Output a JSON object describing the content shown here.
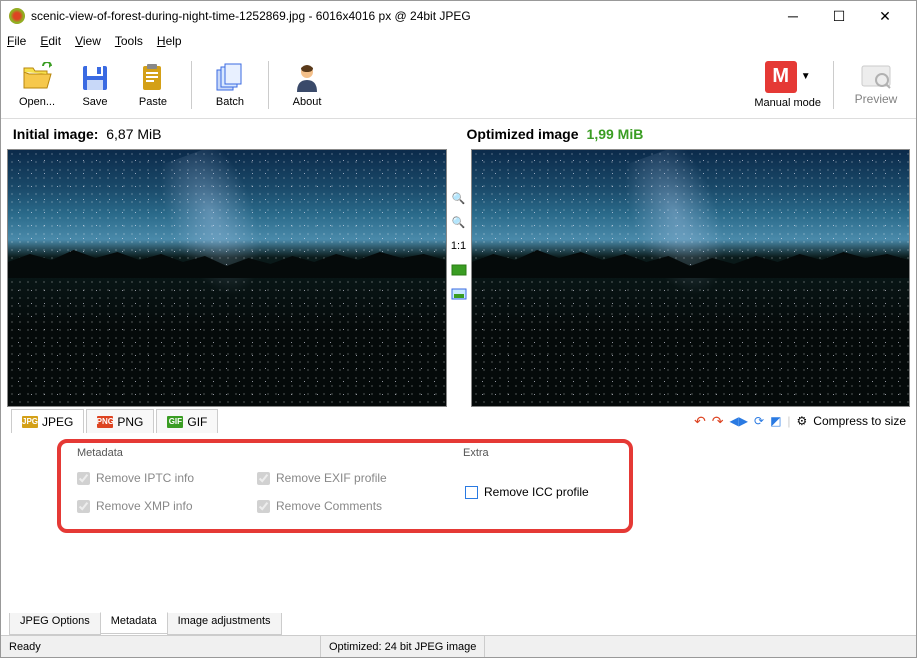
{
  "window": {
    "title": "scenic-view-of-forest-during-night-time-1252869.jpg - 6016x4016 px @ 24bit JPEG"
  },
  "menu": {
    "file": "File",
    "edit": "Edit",
    "view": "View",
    "tools": "Tools",
    "help": "Help"
  },
  "toolbar": {
    "open": "Open...",
    "save": "Save",
    "paste": "Paste",
    "batch": "Batch",
    "about": "About",
    "mode": "Manual mode",
    "preview": "Preview"
  },
  "info": {
    "initial_label": "Initial image:",
    "initial_size": "6,87 MiB",
    "optimized_label": "Optimized image",
    "optimized_size": "1,99 MiB"
  },
  "mid": {
    "ratio": "1:1"
  },
  "formats": {
    "jpeg": "JPEG",
    "png": "PNG",
    "gif": "GIF"
  },
  "right_tools": {
    "compress": "Compress to size"
  },
  "groups": {
    "metadata": "Metadata",
    "extra": "Extra"
  },
  "metadata": {
    "iptc": "Remove IPTC info",
    "exif": "Remove EXIF profile",
    "xmp": "Remove XMP info",
    "comments": "Remove Comments"
  },
  "extra": {
    "icc": "Remove ICC profile"
  },
  "tabs": {
    "jpeg_options": "JPEG Options",
    "metadata": "Metadata",
    "adjustments": "Image adjustments"
  },
  "status": {
    "ready": "Ready",
    "optimized": "Optimized: 24 bit JPEG image"
  }
}
